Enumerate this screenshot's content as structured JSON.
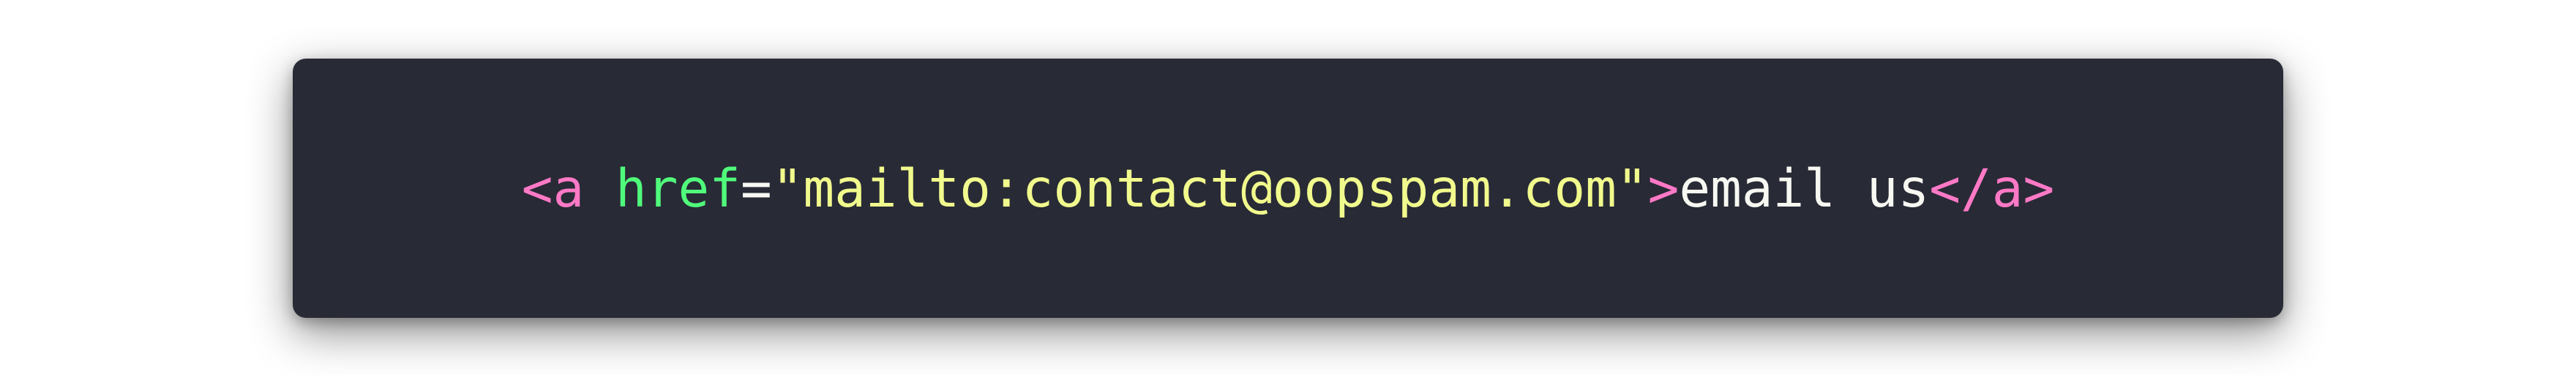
{
  "code": {
    "open_lt": "<",
    "open_tag": "a",
    "space": " ",
    "attr_name": "href",
    "equals": "=",
    "attr_value": "\"mailto:contact@oopspam.com\"",
    "open_gt": ">",
    "inner_text": "email us",
    "close_tag": "</a>"
  },
  "colors": {
    "background": "#282a36",
    "tag": "#ff79c6",
    "attribute": "#50fa7b",
    "string": "#f1fa8c",
    "text": "#f8f8f2"
  }
}
